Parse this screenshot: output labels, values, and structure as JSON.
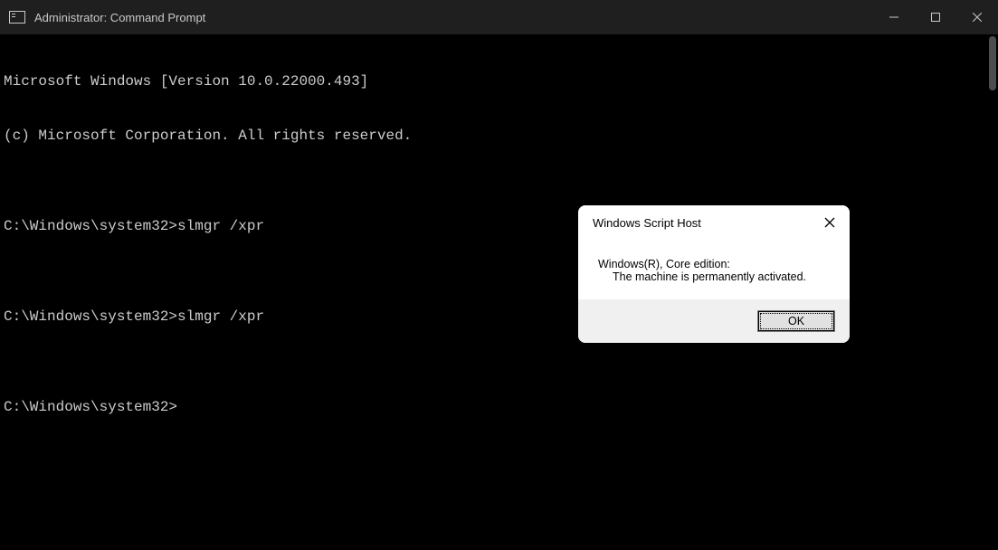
{
  "window": {
    "title": "Administrator: Command Prompt"
  },
  "terminal": {
    "lines": [
      "Microsoft Windows [Version 10.0.22000.493]",
      "(c) Microsoft Corporation. All rights reserved.",
      "",
      "C:\\Windows\\system32>slmgr /xpr",
      "",
      "C:\\Windows\\system32>slmgr /xpr",
      "",
      "C:\\Windows\\system32>"
    ]
  },
  "dialog": {
    "title": "Windows Script Host",
    "message_line1": "Windows(R), Core edition:",
    "message_line2": "The machine is permanently activated.",
    "ok_label": "OK"
  }
}
